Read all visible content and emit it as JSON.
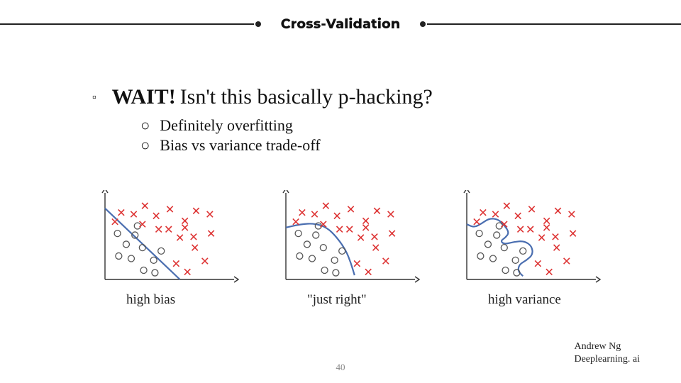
{
  "header": {
    "title": "Cross-Validation"
  },
  "bullets": {
    "l1_bold": "WAIT!",
    "l1_rest": "Isn't this basically p-hacking?",
    "l2_a": "Definitely overfitting",
    "l2_b": "Bias vs variance trade-off"
  },
  "figures": {
    "left": {
      "caption": "high bias"
    },
    "center": {
      "caption": "\"just right\""
    },
    "right": {
      "caption": "high variance"
    }
  },
  "credit": {
    "line1": "Andrew Ng",
    "line2": "Deeplearning. ai"
  },
  "page_number": "40",
  "chart_data": [
    {
      "type": "scatter",
      "title": "high bias",
      "xlabel": "",
      "ylabel": "",
      "xlim": [
        0,
        10
      ],
      "ylim": [
        0,
        10
      ],
      "series": [
        {
          "name": "class-circle",
          "marker": "o",
          "points": [
            [
              1.0,
              5.5
            ],
            [
              1.7,
              4.2
            ],
            [
              1.1,
              2.8
            ],
            [
              2.4,
              5.3
            ],
            [
              3.0,
              3.8
            ],
            [
              2.1,
              2.5
            ],
            [
              3.1,
              1.1
            ],
            [
              3.9,
              2.3
            ],
            [
              4.5,
              3.4
            ],
            [
              2.6,
              6.4
            ],
            [
              4.0,
              0.8
            ]
          ]
        },
        {
          "name": "class-x",
          "marker": "x",
          "points": [
            [
              1.3,
              8.0
            ],
            [
              2.3,
              7.8
            ],
            [
              3.2,
              8.8
            ],
            [
              4.1,
              7.6
            ],
            [
              5.2,
              8.4
            ],
            [
              6.4,
              7.0
            ],
            [
              7.3,
              8.2
            ],
            [
              6.0,
              5.0
            ],
            [
              7.2,
              3.8
            ],
            [
              8.0,
              2.2
            ],
            [
              8.5,
              5.5
            ],
            [
              8.4,
              7.8
            ],
            [
              5.7,
              1.9
            ],
            [
              6.6,
              0.9
            ],
            [
              4.3,
              6.0
            ],
            [
              3.0,
              6.6
            ],
            [
              6.4,
              6.2
            ],
            [
              7.1,
              5.1
            ],
            [
              0.8,
              6.9
            ],
            [
              5.1,
              6.0
            ]
          ]
        }
      ],
      "boundary": {
        "kind": "line",
        "points": [
          [
            0,
            8.5
          ],
          [
            6.0,
            0
          ]
        ]
      }
    },
    {
      "type": "scatter",
      "title": "\"just right\"",
      "xlabel": "",
      "ylabel": "",
      "xlim": [
        0,
        10
      ],
      "ylim": [
        0,
        10
      ],
      "series": [
        {
          "name": "class-circle",
          "marker": "o",
          "points": [
            [
              1.0,
              5.5
            ],
            [
              1.7,
              4.2
            ],
            [
              1.1,
              2.8
            ],
            [
              2.4,
              5.3
            ],
            [
              3.0,
              3.8
            ],
            [
              2.1,
              2.5
            ],
            [
              3.1,
              1.1
            ],
            [
              3.9,
              2.3
            ],
            [
              4.5,
              3.4
            ],
            [
              2.6,
              6.4
            ],
            [
              4.0,
              0.8
            ]
          ]
        },
        {
          "name": "class-x",
          "marker": "x",
          "points": [
            [
              1.3,
              8.0
            ],
            [
              2.3,
              7.8
            ],
            [
              3.2,
              8.8
            ],
            [
              4.1,
              7.6
            ],
            [
              5.2,
              8.4
            ],
            [
              6.4,
              7.0
            ],
            [
              7.3,
              8.2
            ],
            [
              6.0,
              5.0
            ],
            [
              7.2,
              3.8
            ],
            [
              8.0,
              2.2
            ],
            [
              8.5,
              5.5
            ],
            [
              8.4,
              7.8
            ],
            [
              5.7,
              1.9
            ],
            [
              6.6,
              0.9
            ],
            [
              4.3,
              6.0
            ],
            [
              3.0,
              6.6
            ],
            [
              6.4,
              6.2
            ],
            [
              7.1,
              5.1
            ],
            [
              0.8,
              6.9
            ],
            [
              5.1,
              6.0
            ]
          ]
        }
      ],
      "boundary": {
        "kind": "curve",
        "points": [
          [
            0,
            6.2
          ],
          [
            1.2,
            6.6
          ],
          [
            2.3,
            6.7
          ],
          [
            3.3,
            6.2
          ],
          [
            4.1,
            5.0
          ],
          [
            4.8,
            3.5
          ],
          [
            5.2,
            2.0
          ],
          [
            5.5,
            0.5
          ]
        ]
      }
    },
    {
      "type": "scatter",
      "title": "high variance",
      "xlabel": "",
      "ylabel": "",
      "xlim": [
        0,
        10
      ],
      "ylim": [
        0,
        10
      ],
      "series": [
        {
          "name": "class-circle",
          "marker": "o",
          "points": [
            [
              1.0,
              5.5
            ],
            [
              1.7,
              4.2
            ],
            [
              1.1,
              2.8
            ],
            [
              2.4,
              5.3
            ],
            [
              3.0,
              3.8
            ],
            [
              2.1,
              2.5
            ],
            [
              3.1,
              1.1
            ],
            [
              3.9,
              2.3
            ],
            [
              4.5,
              3.4
            ],
            [
              2.6,
              6.4
            ],
            [
              4.0,
              0.8
            ]
          ]
        },
        {
          "name": "class-x",
          "marker": "x",
          "points": [
            [
              1.3,
              8.0
            ],
            [
              2.3,
              7.8
            ],
            [
              3.2,
              8.8
            ],
            [
              4.1,
              7.6
            ],
            [
              5.2,
              8.4
            ],
            [
              6.4,
              7.0
            ],
            [
              7.3,
              8.2
            ],
            [
              6.0,
              5.0
            ],
            [
              7.2,
              3.8
            ],
            [
              8.0,
              2.2
            ],
            [
              8.5,
              5.5
            ],
            [
              8.4,
              7.8
            ],
            [
              5.7,
              1.9
            ],
            [
              6.6,
              0.9
            ],
            [
              4.3,
              6.0
            ],
            [
              3.0,
              6.6
            ],
            [
              6.4,
              6.2
            ],
            [
              7.1,
              5.1
            ],
            [
              0.8,
              6.9
            ],
            [
              5.1,
              6.0
            ]
          ]
        }
      ],
      "boundary": {
        "kind": "curve",
        "points": [
          [
            0,
            6.6
          ],
          [
            0.6,
            6.2
          ],
          [
            1.2,
            6.7
          ],
          [
            1.8,
            7.3
          ],
          [
            2.5,
            7.2
          ],
          [
            3.0,
            6.5
          ],
          [
            3.4,
            5.6
          ],
          [
            3.1,
            5.0
          ],
          [
            2.7,
            4.6
          ],
          [
            3.0,
            4.2
          ],
          [
            3.8,
            4.5
          ],
          [
            4.6,
            4.6
          ],
          [
            5.2,
            4.0
          ],
          [
            5.3,
            3.0
          ],
          [
            4.8,
            2.3
          ],
          [
            4.2,
            1.8
          ],
          [
            4.1,
            1.0
          ],
          [
            4.5,
            0.4
          ]
        ]
      }
    }
  ]
}
